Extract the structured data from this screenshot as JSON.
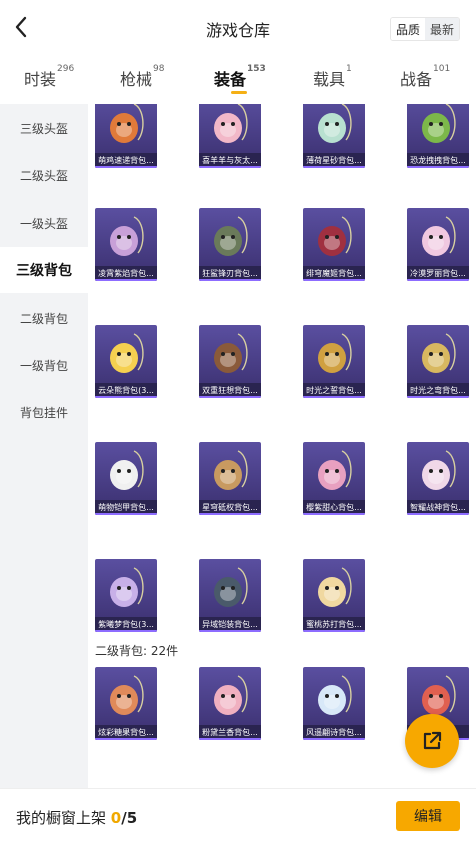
{
  "header": {
    "title": "游戏仓库",
    "sort_options": [
      "品质",
      "最新"
    ]
  },
  "tabs": [
    {
      "label": "时装",
      "count": "296"
    },
    {
      "label": "枪械",
      "count": "98"
    },
    {
      "label": "装备",
      "count": "153"
    },
    {
      "label": "载具",
      "count": "1"
    },
    {
      "label": "战备",
      "count": "101"
    }
  ],
  "sidebar": {
    "items": [
      "三级头盔",
      "二级头盔",
      "一级头盔",
      "三级背包",
      "二级背包",
      "一级背包",
      "背包挂件"
    ],
    "active_index": 3
  },
  "grid": {
    "items": [
      {
        "name": "萌鸡速递背包...",
        "icon": "backpack-icon",
        "color": "#e07a3a"
      },
      {
        "name": "喜羊羊与灰太...",
        "icon": "backpack-icon",
        "color": "#f2b8c8"
      },
      {
        "name": "薄荷星砂背包...",
        "icon": "backpack-icon",
        "color": "#b8e0d0"
      },
      {
        "name": "恐龙拽拽背包...",
        "icon": "backpack-icon",
        "color": "#7cb84a"
      },
      {
        "name": "凌霄紫焰背包...",
        "icon": "backpack-icon",
        "color": "#c8a0d8"
      },
      {
        "name": "狂鲨锋刃背包...",
        "icon": "backpack-icon",
        "color": "#6a7a5a"
      },
      {
        "name": "绯穹魔姬背包...",
        "icon": "backpack-icon",
        "color": "#a03040"
      },
      {
        "name": "冷漠罗丽背包...",
        "icon": "backpack-icon",
        "color": "#f0c8e0"
      },
      {
        "name": "云朵熊背包(3...",
        "icon": "backpack-icon",
        "color": "#f5d050"
      },
      {
        "name": "双重狂想背包...",
        "icon": "backpack-icon",
        "color": "#8a5a3a"
      },
      {
        "name": "时光之誓背包...",
        "icon": "backpack-icon",
        "color": "#d0a040"
      },
      {
        "name": "时光之弯背包...",
        "icon": "backpack-icon",
        "color": "#d8b860"
      },
      {
        "name": "萌物铠甲背包...",
        "icon": "backpack-icon",
        "color": "#f0f0f0"
      },
      {
        "name": "星穹砥权背包...",
        "icon": "backpack-icon",
        "color": "#c89a60"
      },
      {
        "name": "樱紫甜心背包...",
        "icon": "backpack-icon",
        "color": "#e8a0c0"
      },
      {
        "name": "智耀战神背包...",
        "icon": "backpack-icon",
        "color": "#f0d8e8"
      },
      {
        "name": "紫曦梦背包(3...",
        "icon": "backpack-icon",
        "color": "#c8b0e8"
      },
      {
        "name": "异域铠装背包...",
        "icon": "backpack-icon",
        "color": "#4a5a6a"
      },
      {
        "name": "蜜桃苏打背包...",
        "icon": "backpack-icon",
        "color": "#f0d8a0"
      }
    ],
    "section_label": "二级背包: 22件",
    "section_items": [
      {
        "name": "炫彩糖果背包...",
        "icon": "backpack-icon",
        "color": "#e08a5a"
      },
      {
        "name": "粉黛兰香背包...",
        "icon": "backpack-icon",
        "color": "#f0b0c0"
      },
      {
        "name": "风遥翩诗背包...",
        "icon": "backpack-icon",
        "color": "#d8e8f8"
      },
      {
        "name": "",
        "icon": "backpack-icon",
        "color": "#e06050"
      }
    ]
  },
  "bottom": {
    "label": "我的橱窗上架",
    "count": "0",
    "total": "/5",
    "edit_label": "编辑"
  },
  "colors": {
    "accent": "#f7a800",
    "card_bg": "#3a2f6e"
  }
}
